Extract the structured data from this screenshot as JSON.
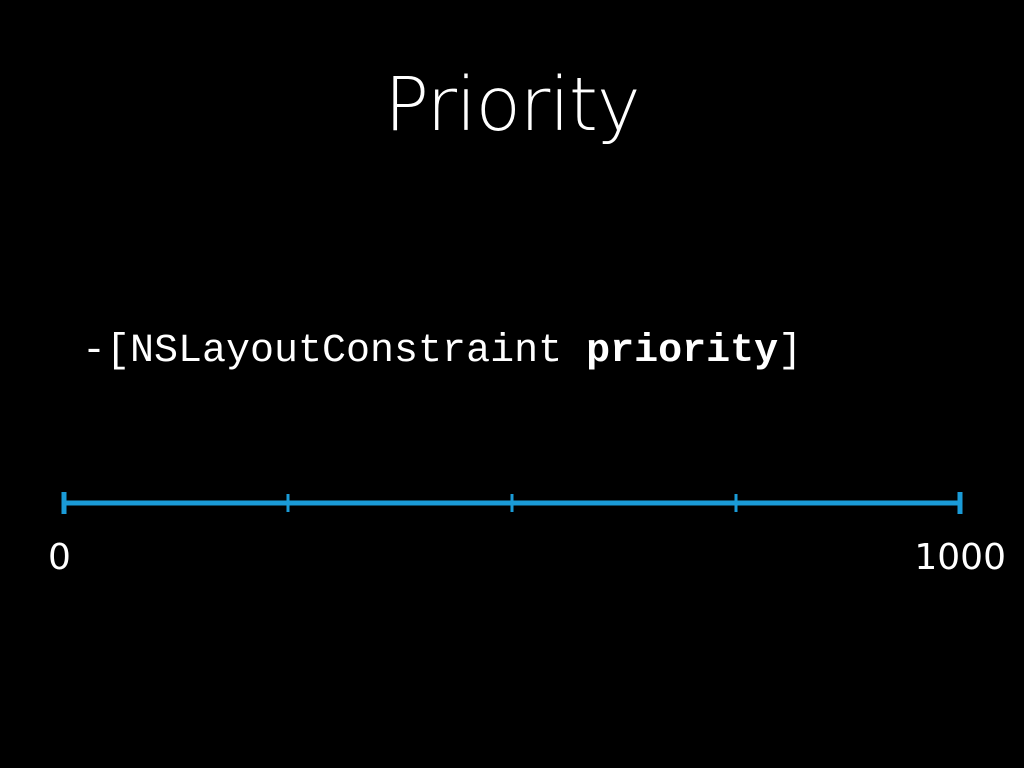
{
  "slide": {
    "title": "Priority",
    "code": {
      "prefix": "-[NSLayoutConstraint ",
      "method": "priority",
      "suffix": "]"
    }
  },
  "priority_scale": {
    "min_label": "0",
    "max_label": "1000",
    "min": 0,
    "max": 1000,
    "ticks": [
      250,
      500,
      750
    ],
    "color": "#1a9bd7"
  }
}
